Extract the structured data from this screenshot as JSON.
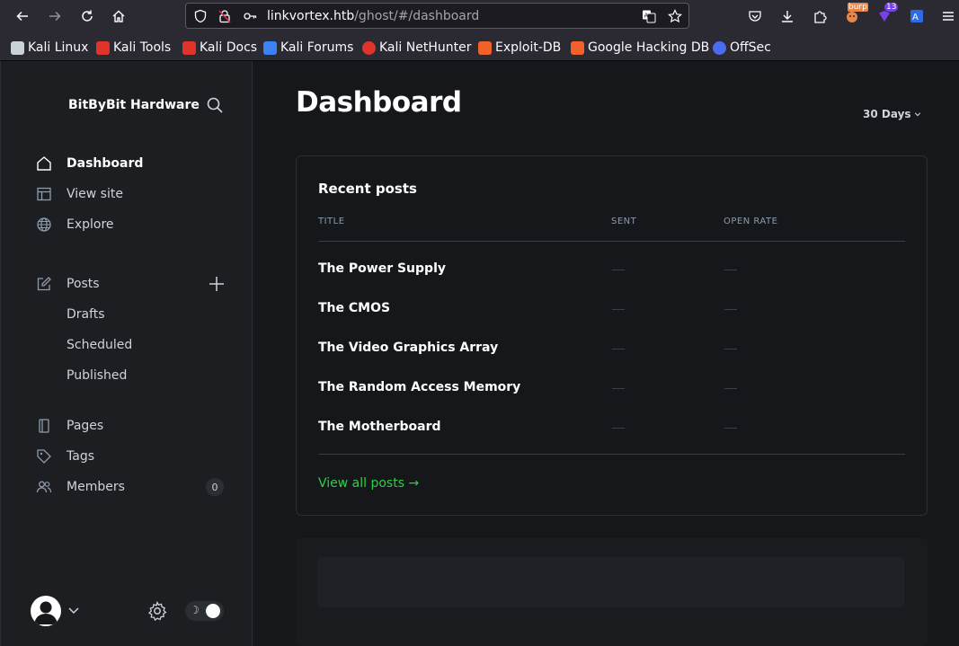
{
  "browser": {
    "url_host": "linkvortex.htb",
    "url_path": "/ghost/#/dashboard",
    "ext_badge_burp": "burp",
    "ext_badge_count": "13",
    "bookmarks": [
      {
        "label": "Kali Linux",
        "color": "#c9d1d9"
      },
      {
        "label": "Kali Tools",
        "color": "#e0342b"
      },
      {
        "label": "Kali Docs",
        "color": "#e0342b"
      },
      {
        "label": "Kali Forums",
        "color": "#3b82f6"
      },
      {
        "label": "Kali NetHunter",
        "color": "#e0342b"
      },
      {
        "label": "Exploit-DB",
        "color": "#f0622a"
      },
      {
        "label": "Google Hacking DB",
        "color": "#f0622a"
      },
      {
        "label": "OffSec",
        "color": "#4b6cf0"
      }
    ]
  },
  "sidebar": {
    "site_name": "BitByBit Hardware",
    "nav": {
      "dashboard": "Dashboard",
      "view_site": "View site",
      "explore": "Explore",
      "posts": "Posts",
      "drafts": "Drafts",
      "scheduled": "Scheduled",
      "published": "Published",
      "pages": "Pages",
      "tags": "Tags",
      "members": "Members",
      "members_count": "0"
    }
  },
  "main": {
    "title": "Dashboard",
    "range": "30 Days",
    "recent_posts": {
      "title": "Recent posts",
      "columns": [
        "TITLE",
        "SENT",
        "OPEN RATE"
      ],
      "rows": [
        {
          "title": "The Power Supply"
        },
        {
          "title": "The CMOS"
        },
        {
          "title": "The Video Graphics Array"
        },
        {
          "title": "The Random Access Memory"
        },
        {
          "title": "The Motherboard"
        }
      ],
      "view_all": "View all posts →"
    }
  },
  "colors": {
    "accent_green": "#30cf43",
    "background": "#15171a",
    "sidebar": "#1c1e21"
  }
}
